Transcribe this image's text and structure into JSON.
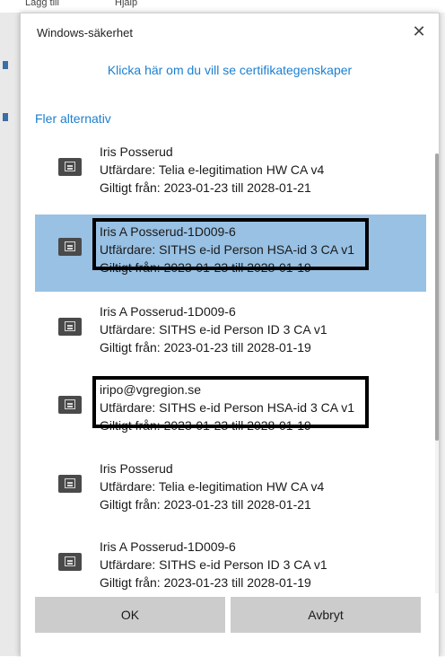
{
  "background": {
    "menu_fragment_1": "Lägg till",
    "menu_fragment_2": "Hjälp"
  },
  "dialog": {
    "title": "Windows-säkerhet",
    "close_glyph": "✕",
    "cert_properties_link": "Klicka här om du vill se certifikategenskaper",
    "more_options_link": "Fler alternativ",
    "ok_label": "OK",
    "cancel_label": "Avbryt"
  },
  "certificates": [
    {
      "name": "Iris Posserud",
      "issuer": "Utfärdare: Telia e-legitimation HW CA v4",
      "valid": "Giltigt från: 2023-01-23 till 2028-01-21",
      "selected": false,
      "icon": "certificate-icon"
    },
    {
      "name": "Iris A Posserud-1D009-6",
      "issuer": "Utfärdare: SITHS e-id Person HSA-id 3 CA v1",
      "valid": "Giltigt från: 2023-01-23 till 2028-01-19",
      "selected": true,
      "icon": "certificate-icon"
    },
    {
      "name": "Iris A Posserud-1D009-6",
      "issuer": "Utfärdare: SITHS e-id Person ID 3 CA v1",
      "valid": "Giltigt från: 2023-01-23 till 2028-01-19",
      "selected": false,
      "icon": "certificate-icon"
    },
    {
      "name": "iripo@vgregion.se",
      "issuer": "Utfärdare: SITHS e-id Person HSA-id 3 CA v1",
      "valid": "Giltigt från: 2023-01-23 till 2028-01-19",
      "selected": false,
      "icon": "certificate-icon"
    },
    {
      "name": "Iris Posserud",
      "issuer": "Utfärdare: Telia e-legitimation HW CA v4",
      "valid": "Giltigt från: 2023-01-23 till 2028-01-21",
      "selected": false,
      "icon": "certificate-icon"
    },
    {
      "name": "Iris A Posserud-1D009-6",
      "issuer": "Utfärdare: SITHS e-id Person ID 3 CA v1",
      "valid": "Giltigt från: 2023-01-23 till 2028-01-19",
      "selected": false,
      "icon": "certificate-icon"
    }
  ],
  "colors": {
    "selection": "#98c1e4",
    "link": "#1b7fd1",
    "button": "#cccccc",
    "annotation_box": "#000000"
  }
}
